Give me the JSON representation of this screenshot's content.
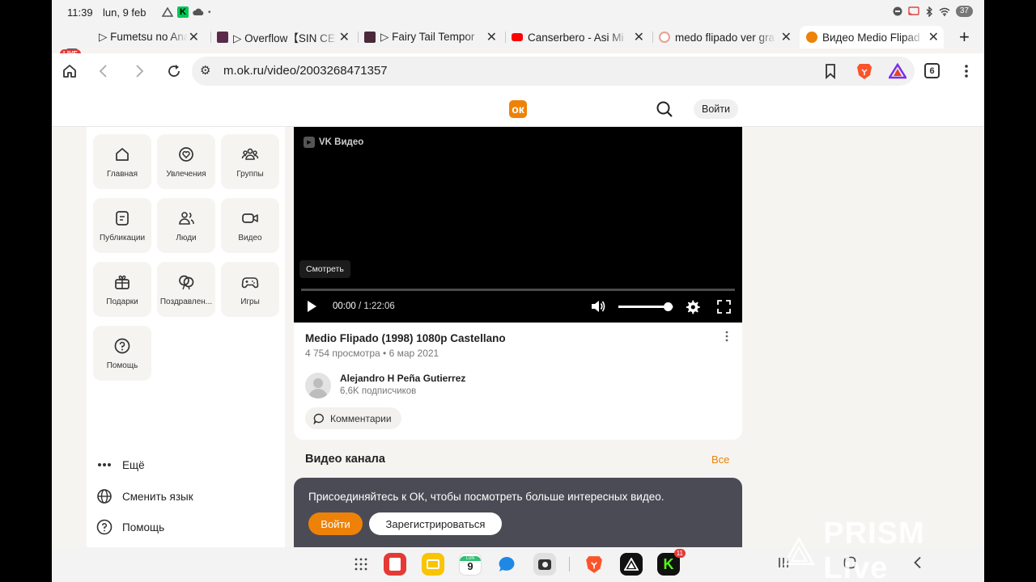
{
  "status_bar": {
    "time": "11:39",
    "date": "lun, 9 feb",
    "notif_badge": "K",
    "battery": "37"
  },
  "live_badge": "LIVE",
  "tabs": [
    {
      "title": "▷ Fumetsu no Anat",
      "favicon_color": "#444444"
    },
    {
      "title": "▷ Overflow【SIN CE",
      "favicon_color": "#5a2a4a"
    },
    {
      "title": "▷ Fairy Tail Tempor",
      "favicon_color": "#4a2a3a"
    },
    {
      "title": "Canserbero - Asi Mi",
      "favicon_color": "#ff0000"
    },
    {
      "title": "medo flipado ver gra",
      "favicon_color": "#e8a090"
    },
    {
      "title": "Видео Medio Flipad",
      "favicon_color": "#ee8208"
    }
  ],
  "toolbar": {
    "url": "m.ok.ru/video/2003268471357",
    "tab_count": "6"
  },
  "site": {
    "logo": "ок",
    "login": "Войти"
  },
  "nav": {
    "tiles": [
      {
        "label": "Главная",
        "icon": "home-icon"
      },
      {
        "label": "Увлечения",
        "icon": "heart-circle-icon"
      },
      {
        "label": "Группы",
        "icon": "groups-icon"
      },
      {
        "label": "Публикации",
        "icon": "publications-icon"
      },
      {
        "label": "Люди",
        "icon": "people-icon"
      },
      {
        "label": "Видео",
        "icon": "video-camera-icon"
      },
      {
        "label": "Подарки",
        "icon": "gift-icon"
      },
      {
        "label": "Поздравлен...",
        "icon": "balloons-icon"
      },
      {
        "label": "Игры",
        "icon": "gamepad-icon"
      },
      {
        "label": "Помощь",
        "icon": "help-icon"
      }
    ],
    "more": "Ещё",
    "language": "Сменить язык",
    "help": "Помощь"
  },
  "player": {
    "brand": "VK Видео",
    "tooltip": "Смотреть",
    "current_time": "00:00",
    "separator": " / ",
    "duration": "1:22:06",
    "progress_fraction": 0.0,
    "volume_fraction": 0.9
  },
  "video": {
    "title": "Medio Flipado (1998) 1080p Castellano",
    "meta": "4 754 просмотра • 6 мар 2021",
    "author": "Alejandro H Peña Gutierrez",
    "subscribers": "6,6K подписчиков",
    "comments": "Комментарии"
  },
  "channel": {
    "heading": "Видео канала",
    "all": "Все"
  },
  "join": {
    "text": "Присоединяйтесь к ОК, чтобы посмотреть больше интересных видео.",
    "login": "Войти",
    "register": "Зарегистрироваться"
  },
  "dock": {
    "calendar_day": "9",
    "calendar_month": "LUN",
    "k_badge": "11"
  },
  "watermark": "PRISM Live"
}
